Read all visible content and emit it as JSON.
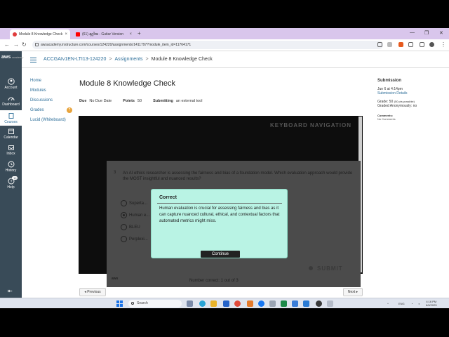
{
  "browser": {
    "tabs": [
      {
        "label": "Module 8 Knowledge Check",
        "active": true
      },
      {
        "label": "(61) മുറ്റിയ - Guitar Version",
        "active": false
      }
    ],
    "url": "awsacademy.instructure.com/courses/124220/assignments/1411797?module_item_id=11764171"
  },
  "global_nav": {
    "logo": "aws",
    "logo_sub": "academy",
    "items": [
      {
        "label": "Account",
        "icon": "user-circle-icon"
      },
      {
        "label": "Dashboard",
        "icon": "dashboard-gauge-icon"
      },
      {
        "label": "Courses",
        "icon": "book-icon",
        "active": true
      },
      {
        "label": "Calendar",
        "icon": "calendar-icon"
      },
      {
        "label": "Inbox",
        "icon": "inbox-icon"
      },
      {
        "label": "History",
        "icon": "clock-icon"
      },
      {
        "label": "Help",
        "icon": "question-icon",
        "badge": "10"
      }
    ]
  },
  "breadcrumb": {
    "course": "ACCGAIv1EN-LTI13-124220",
    "section": "Assignments",
    "current": "Module 8 Knowledge Check",
    "separator": ">"
  },
  "course_nav": {
    "items": [
      "Home",
      "Modules",
      "Discussions",
      "Grades",
      "Lucid (Whiteboard)"
    ],
    "grades_badge": "?"
  },
  "assignment": {
    "title": "Module 8 Knowledge Check",
    "due_label": "Due",
    "due_value": "No Due Date",
    "points_label": "Points",
    "points_value": "50",
    "submitting_label": "Submitting",
    "submitting_value": "an external tool"
  },
  "activity": {
    "keyboard_nav": "KEYBOARD NAVIGATION",
    "question_number": "3",
    "question": "An AI ethics researcher is assessing the fairness and bias of a foundation model. Which evaluation approach would provide the MOST insightful and nuanced results?",
    "options": [
      {
        "label": "Superta...",
        "selected": false
      },
      {
        "label": "Human e...",
        "selected": true
      },
      {
        "label": "BLEU",
        "selected": false
      },
      {
        "label": "Perplexi...",
        "selected": false
      }
    ],
    "logo": "aws",
    "number_correct": "Number correct: 1 out of 3",
    "submit": "SUBMIT"
  },
  "modal": {
    "title": "Correct",
    "body": "Human evaluation is crucial for assessing fairness and bias as it can capture nuanced cultural, ethical, and contextual factors that automated metrics might miss.",
    "button": "Continue"
  },
  "footer_nav": {
    "previous": "◂ Previous",
    "next": "Next ▸"
  },
  "sidebar": {
    "heading": "Submission",
    "submitted_at": "Jun 6 at 4:14pm",
    "details_link": "Submission Details",
    "grade": "Grade: 50",
    "grade_note": "(50 pts possible)",
    "graded_anon": "Graded Anonymously: no",
    "comments_label": "Comments:",
    "comments_value": "No Comments"
  },
  "taskbar": {
    "search_placeholder": "Search",
    "tray_lang": "ENG",
    "time": "4:16 PM",
    "date": "6/6/2025"
  }
}
